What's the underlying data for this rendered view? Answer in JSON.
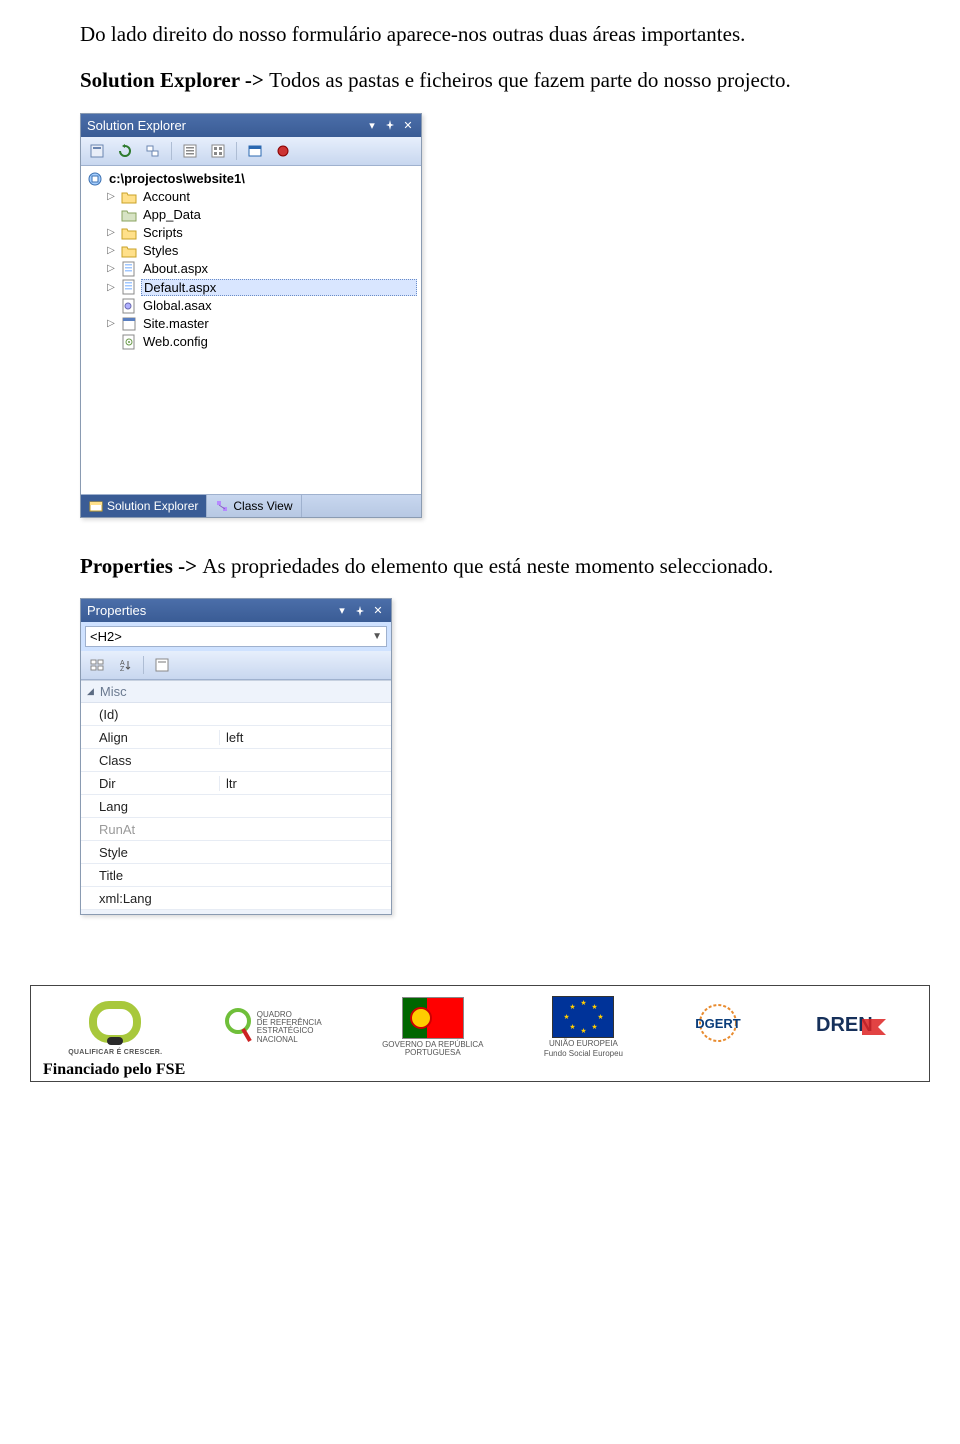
{
  "para1": "Do lado direito do nosso formulário aparece-nos outras duas áreas importantes.",
  "para2_bold": "Solution Explorer -> ",
  "para2_rest": "Todos as pastas e ficheiros que fazem parte do nosso projecto.",
  "para3_bold": "Properties -> ",
  "para3_rest": "As propriedades do elemento que está neste momento seleccionado.",
  "solution_explorer": {
    "title": "Solution Explorer",
    "root": "c:\\projectos\\website1\\",
    "items": [
      {
        "label": "Account",
        "icon": "folder",
        "expander": true
      },
      {
        "label": "App_Data",
        "icon": "folder-special",
        "expander": false
      },
      {
        "label": "Scripts",
        "icon": "folder",
        "expander": true
      },
      {
        "label": "Styles",
        "icon": "folder",
        "expander": true
      },
      {
        "label": "About.aspx",
        "icon": "aspx",
        "expander": true
      },
      {
        "label": "Default.aspx",
        "icon": "aspx",
        "expander": true,
        "selected": true
      },
      {
        "label": "Global.asax",
        "icon": "asax",
        "expander": false
      },
      {
        "label": "Site.master",
        "icon": "master",
        "expander": true
      },
      {
        "label": "Web.config",
        "icon": "config",
        "expander": false
      }
    ],
    "tabs": [
      {
        "label": "Solution Explorer",
        "active": true
      },
      {
        "label": "Class View",
        "active": false
      }
    ]
  },
  "properties": {
    "title": "Properties",
    "selected_element": "<H2>",
    "group": "Misc",
    "rows": [
      {
        "name": "(Id)",
        "value": ""
      },
      {
        "name": "Align",
        "value": "left"
      },
      {
        "name": "Class",
        "value": ""
      },
      {
        "name": "Dir",
        "value": "ltr"
      },
      {
        "name": "Lang",
        "value": ""
      },
      {
        "name": "RunAt",
        "value": "",
        "dim": true
      },
      {
        "name": "Style",
        "value": ""
      },
      {
        "name": "Title",
        "value": ""
      },
      {
        "name": "xml:Lang",
        "value": ""
      }
    ]
  },
  "footer": {
    "qualificar": "QUALIFICAR É CRESCER.",
    "qren": "QUADRO\nDE REFERÊNCIA\nESTRATÉGICO\nNACIONAL",
    "gov": "GOVERNO DA REPÚBLICA\nPORTUGUESA",
    "ue1": "UNIÃO EUROPEIA",
    "ue2": "Fundo Social Europeu",
    "dgert": "DGERT",
    "dren": "DREN",
    "financed": "Financiado pelo FSE"
  }
}
